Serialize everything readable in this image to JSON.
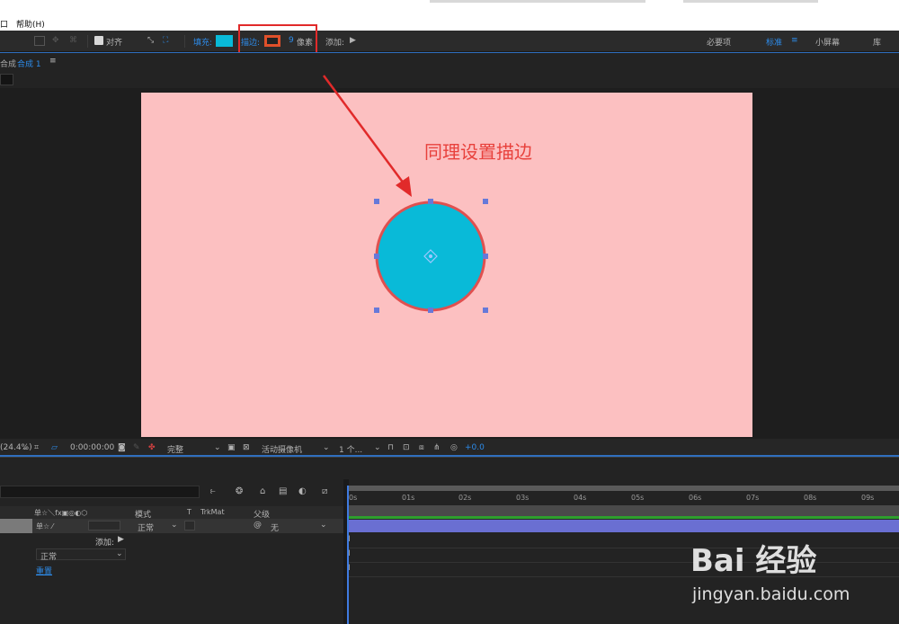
{
  "menu": {
    "left_fragment": "口",
    "help": "帮助(H)"
  },
  "toolbar": {
    "align_label": "对齐",
    "fill_label": "填充:",
    "stroke_label": "描边:",
    "stroke_width_value": "9",
    "stroke_width_unit": "像素",
    "add_label": "添加:",
    "workspaces": [
      "必要项",
      "标准",
      "小屏幕",
      "库"
    ],
    "active_workspace": "标准",
    "fill_color": "#09bad8",
    "stroke_color": "#e0502a"
  },
  "comp": {
    "tab_prefix": "合成",
    "tab_name": "合成 1",
    "menu_icon": "≡",
    "background_color": "#fcc0c1",
    "circle_fill": "#09bad8",
    "circle_stroke": "#e0504f"
  },
  "annotation": {
    "text": "同理设置描边"
  },
  "viewer_footer": {
    "zoom": "(24.4%)",
    "timecode": "0:00:00:00",
    "resolution": "完整",
    "camera": "活动摄像机",
    "views": "1 个...",
    "exposure": "+0.0"
  },
  "timeline": {
    "col_icons": "单☆＼fx▣◎◐⬡",
    "col_mode": "模式",
    "col_t": "T",
    "col_trkmat": "TrkMat",
    "col_parent": "父级",
    "layer_mode": "正常",
    "layer_parent": "无",
    "add_label": "添加:",
    "blend_mode": "正常",
    "reset_label": "重置",
    "ruler_ticks": [
      "0s",
      "01s",
      "02s",
      "03s",
      "04s",
      "05s",
      "06s",
      "07s",
      "08s",
      "09s"
    ]
  },
  "watermark": {
    "brand": "Bai 经验",
    "url": "jingyan.baidu.com"
  }
}
